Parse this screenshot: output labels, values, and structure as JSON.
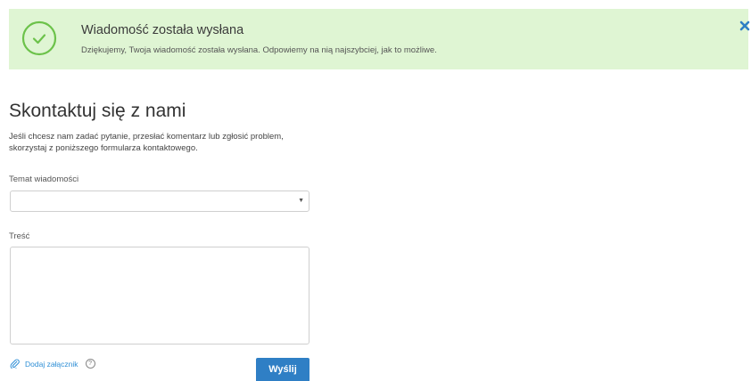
{
  "alert": {
    "title": "Wiadomość została wysłana",
    "message": "Dziękujemy, Twoja wiadomość została wysłana. Odpowiemy na nią najszybciej, jak to możliwe.",
    "icon": "check-circle-icon",
    "close_icon": "close-icon",
    "color_bg": "#dff5d3",
    "color_icon": "#6cc24a"
  },
  "form": {
    "title": "Skontaktuj się z nami",
    "intro_line1": "Jeśli chcesz nam zadać pytanie, przesłać komentarz lub zgłosić problem,",
    "intro_line2": "skorzystaj z poniższego formularza kontaktowego.",
    "subject_label": "Temat wiadomości",
    "subject_value": "",
    "body_label": "Treść",
    "body_value": "",
    "attach_label": "Dodaj załącznik",
    "attach_help": "?",
    "send_label": "Wyślij",
    "accent_color": "#2f7fc5"
  }
}
